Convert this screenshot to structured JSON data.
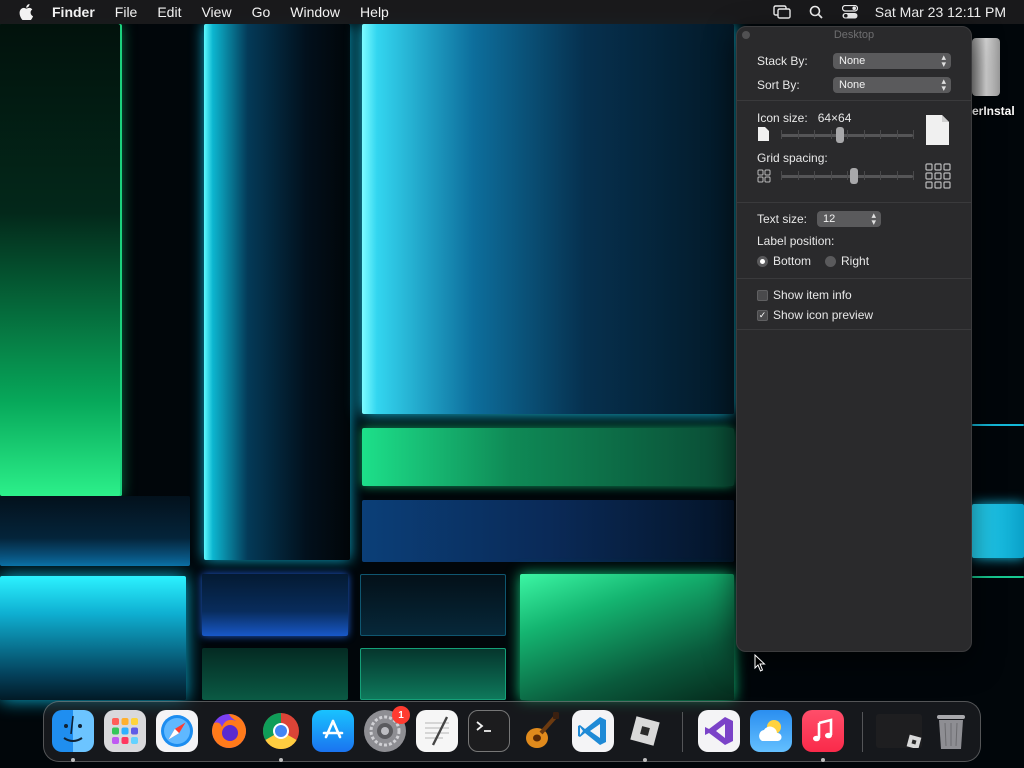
{
  "menubar": {
    "app_name": "Finder",
    "menus": [
      "File",
      "Edit",
      "View",
      "Go",
      "Window",
      "Help"
    ],
    "clock": "Sat Mar 23  12:11 PM",
    "status_icons": [
      "screen-mirroring-icon",
      "spotlight-search-icon",
      "control-center-icon"
    ]
  },
  "desktop_item": {
    "label": "erInstal"
  },
  "panel": {
    "title": "Desktop",
    "stack_by": {
      "label": "Stack By:",
      "value": "None"
    },
    "sort_by": {
      "label": "Sort By:",
      "value": "None"
    },
    "icon_size": {
      "label": "Icon size:",
      "value": "64×64",
      "level": 0.45
    },
    "grid_spacing": {
      "label": "Grid spacing:",
      "level": 0.55
    },
    "text_size": {
      "label": "Text size:",
      "value": "12"
    },
    "label_position": {
      "label": "Label position:",
      "options": [
        "Bottom",
        "Right"
      ],
      "selected": "Bottom"
    },
    "show_item_info": {
      "label": "Show item info",
      "checked": false
    },
    "show_icon_preview": {
      "label": "Show icon preview",
      "checked": true
    }
  },
  "dock": {
    "apps": [
      {
        "name": "finder-icon",
        "running": true
      },
      {
        "name": "launchpad-icon",
        "running": false
      },
      {
        "name": "safari-icon",
        "running": false
      },
      {
        "name": "firefox-icon",
        "running": false
      },
      {
        "name": "chrome-icon",
        "running": true
      },
      {
        "name": "app-store-icon",
        "running": false
      },
      {
        "name": "system-settings-icon",
        "running": false,
        "badge": "1"
      },
      {
        "name": "textedit-icon",
        "running": false
      },
      {
        "name": "terminal-icon",
        "running": false
      },
      {
        "name": "garageband-icon",
        "running": false
      },
      {
        "name": "vscode-icon",
        "running": false
      },
      {
        "name": "roblox-icon",
        "running": true
      },
      {
        "name": "visual-studio-icon",
        "running": false
      },
      {
        "name": "weather-icon",
        "running": false
      },
      {
        "name": "music-icon",
        "running": true
      },
      {
        "name": "roblox-window-icon",
        "running": false
      },
      {
        "name": "trash-icon",
        "running": false
      }
    ]
  }
}
